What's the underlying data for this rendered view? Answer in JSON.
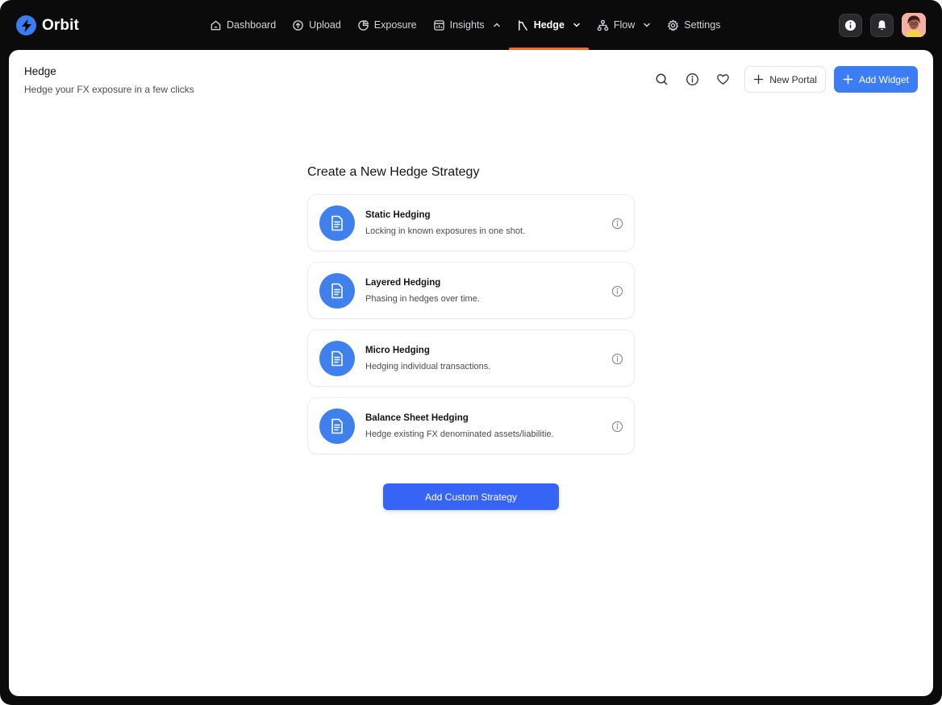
{
  "app": {
    "name": "Orbit"
  },
  "nav": [
    {
      "label": "Dashboard",
      "icon": "home-icon",
      "active": false
    },
    {
      "label": "Upload",
      "icon": "upload-icon",
      "active": false
    },
    {
      "label": "Exposure",
      "icon": "pie-chart-icon",
      "active": false
    },
    {
      "label": "Insights",
      "icon": "insights-icon",
      "active": false,
      "chevron": "up"
    },
    {
      "label": "Hedge",
      "icon": "hedge-icon",
      "active": true,
      "chevron": "down"
    },
    {
      "label": "Flow",
      "icon": "flow-icon",
      "active": false,
      "chevron": "down"
    },
    {
      "label": "Settings",
      "icon": "gear-icon",
      "active": false
    }
  ],
  "header": {
    "title": "Hedge",
    "subtitle": "Hedge your FX exposure in a few clicks",
    "new_portal_label": "New Portal",
    "add_widget_label": "Add Widget"
  },
  "strategy": {
    "heading": "Create a New Hedge Strategy",
    "options": [
      {
        "title": "Static Hedging",
        "description": "Locking in known exposures in one shot."
      },
      {
        "title": "Layered Hedging",
        "description": "Phasing in hedges over time."
      },
      {
        "title": "Micro Hedging",
        "description": "Hedging individual transactions."
      },
      {
        "title": "Balance Sheet Hedging",
        "description": "Hedge existing FX denominated assets/liabilitie."
      }
    ],
    "custom_button_label": "Add Custom Strategy"
  },
  "colors": {
    "accent_blue": "#3d7df3",
    "primary_button": "#3564f6",
    "active_underline": "#f26b2a",
    "topbar_bg": "#0b0b0c"
  }
}
